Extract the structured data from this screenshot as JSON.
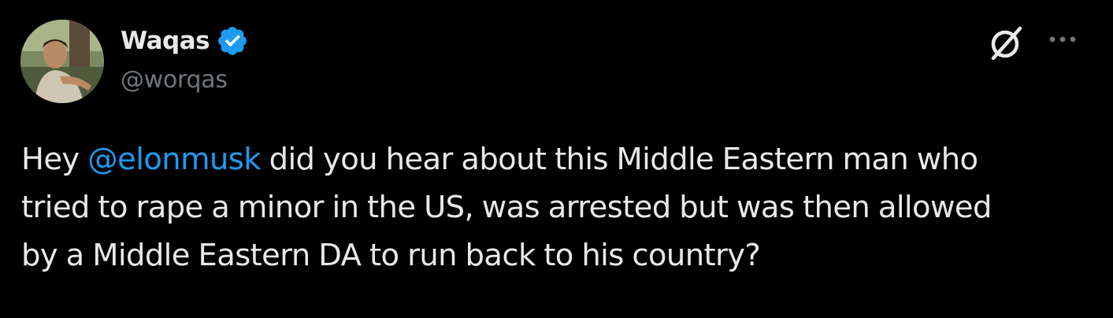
{
  "tweet": {
    "author": {
      "display_name": "Waqas",
      "handle": "@worqas",
      "verified": true,
      "avatar_icon": "profile-photo"
    },
    "actions": {
      "grok_icon": "grok-icon",
      "more_icon": "more-horizontal-icon"
    },
    "text": {
      "prefix": "Hey ",
      "mention": "@elonmusk",
      "line1_rest": " did you hear about this Middle Eastern man who",
      "line2": "tried to rape a minor in the US, was arrested but was then allowed",
      "line3": "by a Middle Eastern DA to run back to his country?"
    },
    "colors": {
      "background": "#000000",
      "text": "#e7e9ea",
      "secondary": "#71767b",
      "accent": "#1d9bf0"
    }
  }
}
